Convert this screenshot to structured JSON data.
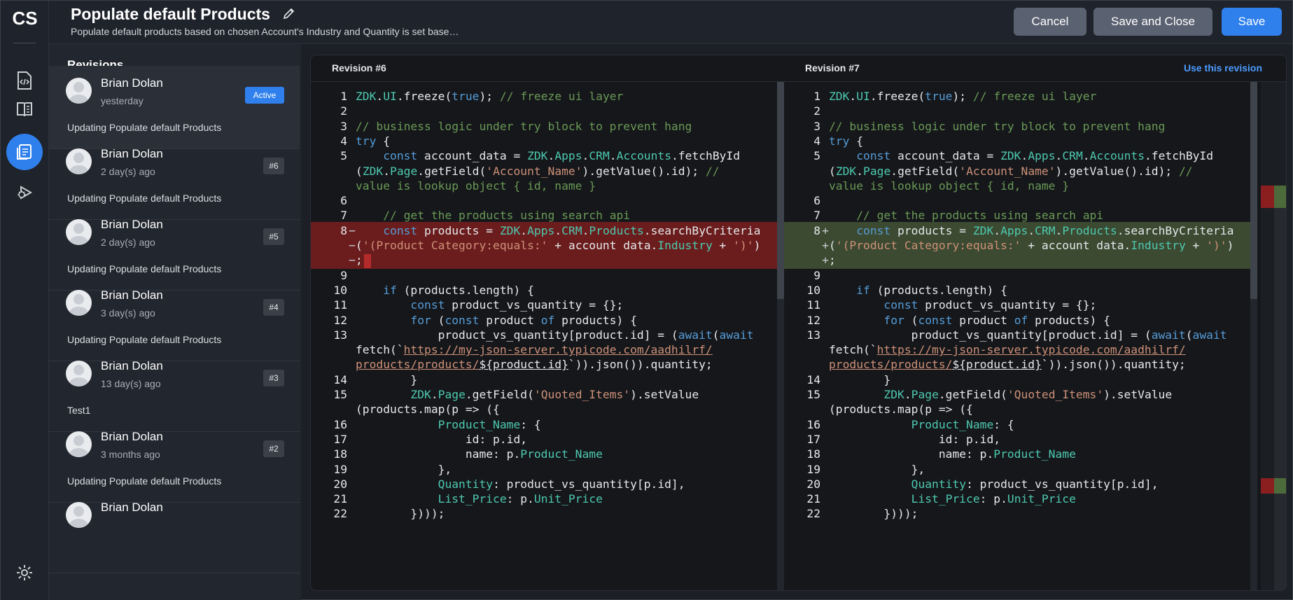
{
  "app": {
    "logo": "CS"
  },
  "rail": {
    "items": [
      {
        "name": "code-icon"
      },
      {
        "name": "book-icon"
      },
      {
        "name": "revisions-icon",
        "active": true
      },
      {
        "name": "debug-icon"
      },
      {
        "name": "settings-icon"
      }
    ]
  },
  "header": {
    "title": "Populate default Products",
    "subtitle": "Populate default products based on chosen Account's Industry and Quantity is set base…",
    "cancel_label": "Cancel",
    "save_close_label": "Save and Close",
    "save_label": "Save"
  },
  "revisions": {
    "heading": "Revisions",
    "items": [
      {
        "author": "Brian Dolan",
        "time": "yesterday",
        "desc": "Updating Populate default Products",
        "badge": "Active",
        "active": true
      },
      {
        "author": "Brian Dolan",
        "time": "2 day(s) ago",
        "desc": "Updating Populate default Products",
        "badge": "#6"
      },
      {
        "author": "Brian Dolan",
        "time": "2 day(s) ago",
        "desc": "Updating Populate default Products",
        "badge": "#5"
      },
      {
        "author": "Brian Dolan",
        "time": "3 day(s) ago",
        "desc": "Updating Populate default Products",
        "badge": "#4"
      },
      {
        "author": "Brian Dolan",
        "time": "13 day(s) ago",
        "desc": "Test1",
        "badge": "#3"
      },
      {
        "author": "Brian Dolan",
        "time": "3 months ago",
        "desc": "Updating Populate default Products",
        "badge": "#2"
      },
      {
        "author": "Brian Dolan",
        "time": "",
        "desc": "",
        "badge": ""
      }
    ]
  },
  "diff": {
    "left_label": "Revision #6",
    "right_label": "Revision #7",
    "use_revision_label": "Use this revision",
    "colors": {
      "deleted": "#6b1d1d",
      "added": "#3b4a31",
      "accent": "#2f80ed"
    }
  }
}
